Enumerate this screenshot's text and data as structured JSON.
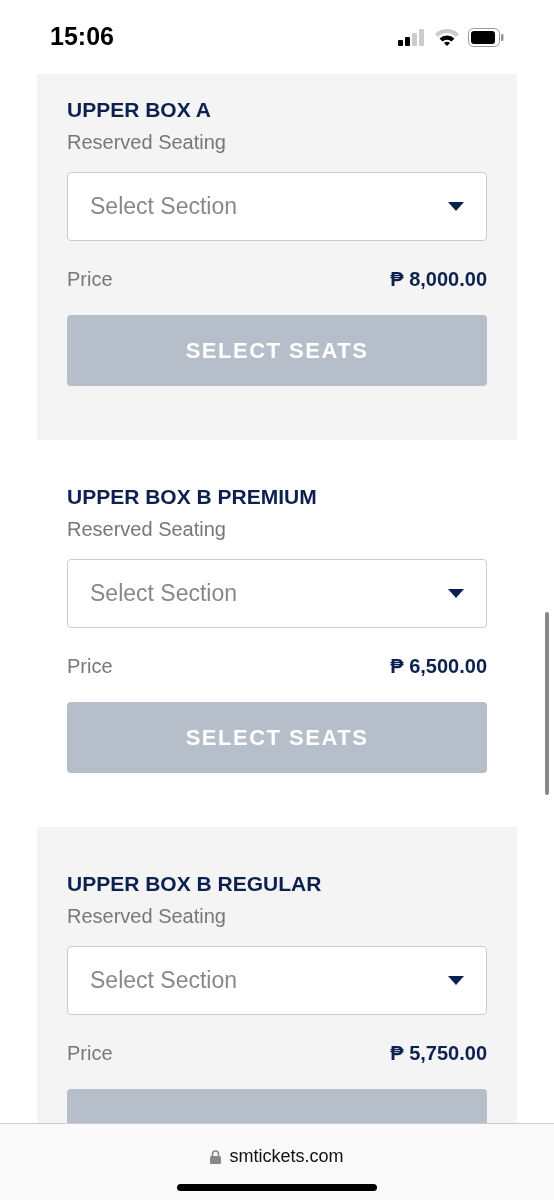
{
  "status_bar": {
    "time": "15:06"
  },
  "sections": [
    {
      "title": "UPPER BOX A",
      "subtitle": "Reserved Seating",
      "placeholder": "Select Section",
      "price_label": "Price",
      "price": "₱ 8,000.00",
      "button": "SELECT SEATS",
      "disabled": true
    },
    {
      "title": "UPPER BOX B PREMIUM",
      "subtitle": "Reserved Seating",
      "placeholder": "Select Section",
      "price_label": "Price",
      "price": "₱ 6,500.00",
      "button": "SELECT SEATS",
      "disabled": true
    },
    {
      "title": "UPPER BOX B REGULAR",
      "subtitle": "Reserved Seating",
      "placeholder": "Select Section",
      "price_label": "Price",
      "price": "₱ 5,750.00",
      "disabled": true
    }
  ],
  "address_bar": {
    "url": "smtickets.com"
  }
}
